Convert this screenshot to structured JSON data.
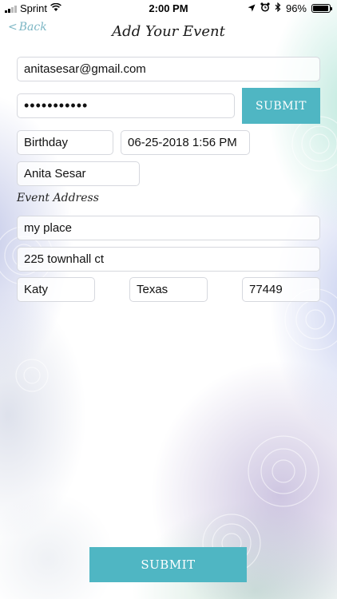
{
  "status_bar": {
    "carrier": "Sprint",
    "time": "2:00 PM",
    "battery_percent": "96%",
    "battery_level": 0.96
  },
  "nav": {
    "back_label": "Back",
    "title": "Add Your Event"
  },
  "form": {
    "email": "anitasesar@gmail.com",
    "password_masked": "•••••••••••",
    "top_submit_label": "SUBMIT",
    "event_type": "Birthday",
    "event_datetime": "06-25-2018 1:56 PM",
    "host_name": "Anita Sesar",
    "address_section_label": "Event Address",
    "place_name": "my place",
    "street": "225 townhall ct",
    "city": "Katy",
    "state": "Texas",
    "zip": "77449",
    "bottom_submit_label": "SUBMIT"
  },
  "colors": {
    "accent": "#4fb6c3",
    "back_link": "#7cb6c4"
  }
}
